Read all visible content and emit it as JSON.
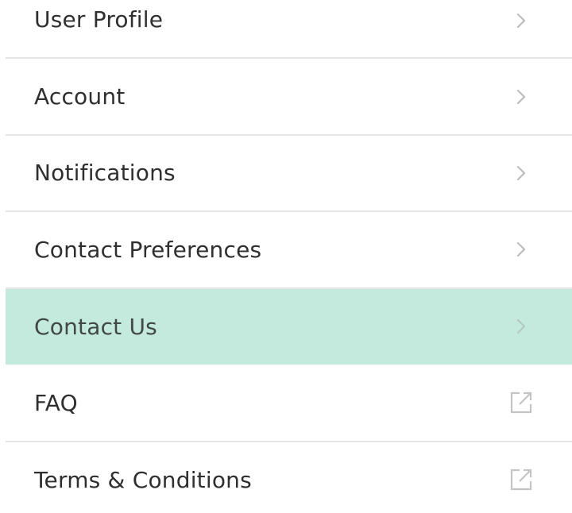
{
  "menu": {
    "items": [
      {
        "label": "User Profile",
        "icon": "chevron-right-icon"
      },
      {
        "label": "Account",
        "icon": "chevron-right-icon"
      },
      {
        "label": "Notifications",
        "icon": "chevron-right-icon"
      },
      {
        "label": "Contact Preferences",
        "icon": "chevron-right-icon"
      },
      {
        "label": "Contact Us",
        "icon": "chevron-right-icon",
        "highlighted": true
      },
      {
        "label": "FAQ",
        "icon": "external-link-icon"
      },
      {
        "label": "Terms & Conditions",
        "icon": "external-link-icon"
      }
    ]
  },
  "colors": {
    "highlight": "#c4eadd",
    "text": "#2f2f2f",
    "divider": "#e5e5e5",
    "icon": "#bdbdbd"
  }
}
